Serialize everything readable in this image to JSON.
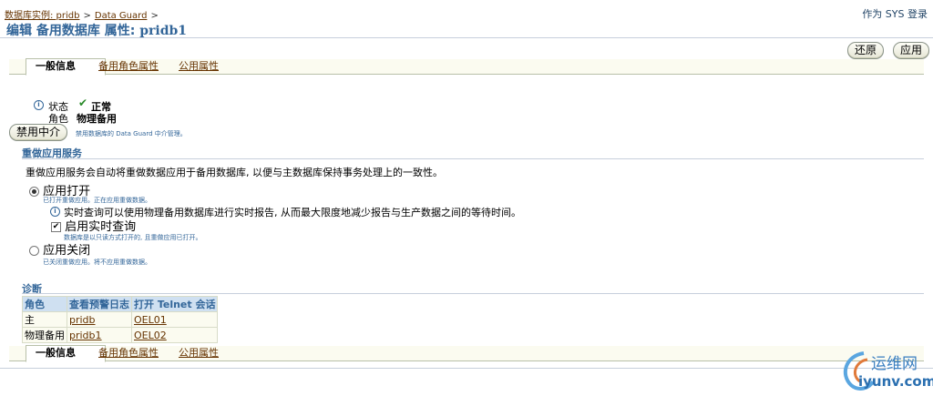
{
  "breadcrumb": {
    "instance": "数据库实例: pridb",
    "dataguard": "Data Guard",
    "sep1": ">",
    "sep2": ">"
  },
  "header": {
    "login": "作为 SYS 登录",
    "title_prefix": "编辑 备用数据库 属性:",
    "title_db": "pridb1"
  },
  "buttons": {
    "revert": "还原",
    "apply": "应用",
    "disable_broker": "禁用中介"
  },
  "tabs": [
    "一般信息",
    "备用角色属性",
    "公用属性"
  ],
  "status": {
    "state_label": "状态",
    "state_value": "正常",
    "role_label": "角色",
    "role_value": "物理备用"
  },
  "broker_note": "禁用数据库的 Data Guard 中介管理。",
  "redo": {
    "section_title": "重做应用服务",
    "description": "重做应用服务会自动将重做数据应用于备用数据库, 以便与主数据库保持事务处理上的一致性。",
    "apply_on": "应用打开",
    "apply_on_note": "已打开重做应用。正在应用重做数据。",
    "realtime_info": "实时查询可以使用物理备用数据库进行实时报告, 从而最大限度地减少报告与生产数据之间的等待时间。",
    "realtime_label": "启用实时查询",
    "realtime_note": "数据库是以只读方式打开的, 且重做应用已打开。",
    "apply_off": "应用关闭",
    "apply_off_note": "已关闭重做应用。将不应用重做数据。"
  },
  "diagnostics": {
    "section_title": "诊断",
    "headers": [
      "角色",
      "查看预警日志",
      "打开 Telnet 会话"
    ],
    "rows": [
      [
        "主",
        "pridb",
        "OEL01"
      ],
      [
        "物理备用",
        "pridb1",
        "OEL02"
      ]
    ]
  },
  "watermark": {
    "line1": "运维网",
    "line2": "iyunv.com"
  },
  "colors": {
    "accent": "#336699",
    "link": "#663300",
    "header_bg": "#cfe0f1"
  }
}
